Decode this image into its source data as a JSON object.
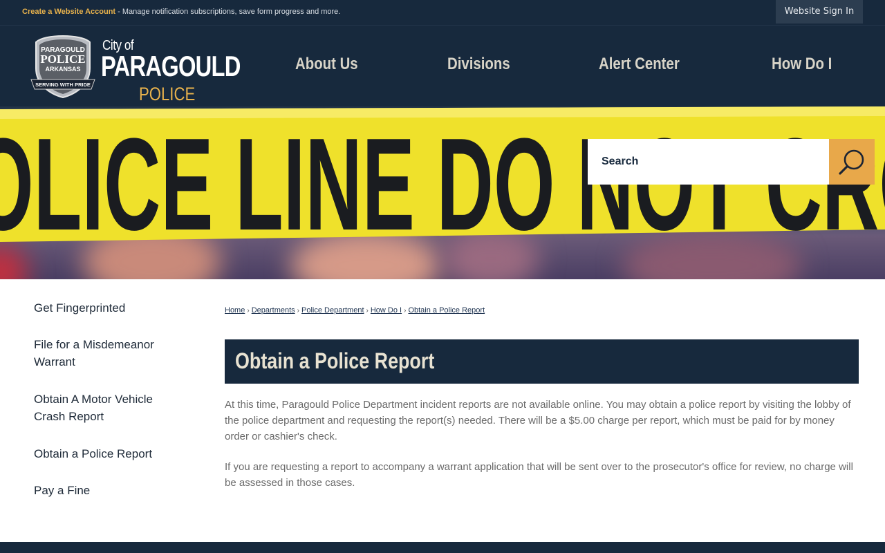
{
  "topbar": {
    "create_account_link": "Create a Website Account",
    "create_account_tail": " - Manage notification subscriptions, save form progress and more.",
    "signin_label": "Website Sign In"
  },
  "logo": {
    "badge_line1": "PARAGOULD",
    "badge_line2": "POLICE",
    "badge_line3": "ARKANSAS",
    "badge_motto": "SERVING WITH PRIDE",
    "city_of": "City of",
    "city_name": "PARAGOULD",
    "department": "POLICE"
  },
  "nav": {
    "items": [
      {
        "label": "About Us"
      },
      {
        "label": "Divisions"
      },
      {
        "label": "Alert Center"
      },
      {
        "label": "How Do I"
      }
    ]
  },
  "hero": {
    "tape_text": "OLICE LINE DO NOT CRO"
  },
  "search": {
    "placeholder": "Search"
  },
  "sidebar": {
    "items": [
      {
        "label": "Get Fingerprinted"
      },
      {
        "label": "File for a Misdemeanor Warrant"
      },
      {
        "label": "Obtain A Motor Vehicle Crash Report"
      },
      {
        "label": "Obtain a Police Report"
      },
      {
        "label": "Pay a Fine"
      }
    ]
  },
  "breadcrumb": [
    {
      "label": "Home"
    },
    {
      "label": "Departments"
    },
    {
      "label": "Police Department"
    },
    {
      "label": "How Do I"
    },
    {
      "label": "Obtain a Police Report"
    }
  ],
  "page": {
    "title": "Obtain a Police Report",
    "paragraphs": [
      "At this time, Paragould Police Department incident reports are not available online.  You may obtain a police report by visiting the lobby of the police department and requesting the report(s) needed.  There will be a $5.00 charge per report, which must be paid for by money order or cashier's check.",
      "If you are requesting a report to accompany a warrant application that will be sent over to the prosecutor's office for review, no charge will be assessed in those cases."
    ]
  },
  "colors": {
    "navy": "#17293d",
    "gold": "#e8b24c",
    "search_button": "#e8a84a",
    "tape_yellow": "#f0e02a"
  },
  "icons": {
    "search_button": "magnifier-icon",
    "badge": "police-badge-icon"
  }
}
